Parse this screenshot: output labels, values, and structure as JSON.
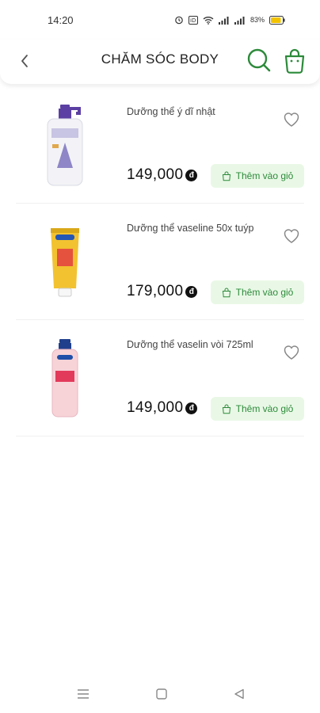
{
  "status_bar": {
    "time": "14:20",
    "battery_percent": "83%"
  },
  "header": {
    "title": "CHĂM SÓC BODY"
  },
  "colors": {
    "accent_green": "#2c8a3a",
    "button_bg": "#e9f8e6"
  },
  "products": [
    {
      "name": "Dưỡng thể ý dĩ nhật",
      "price": "149,000",
      "currency_symbol": "đ",
      "add_to_cart_label": "Thêm vào giỏ"
    },
    {
      "name": "Dưỡng thể vaseline 50x tuýp",
      "price": "179,000",
      "currency_symbol": "đ",
      "add_to_cart_label": "Thêm vào giỏ"
    },
    {
      "name": "Dưỡng thể vaselin vòi 725ml",
      "price": "149,000",
      "currency_symbol": "đ",
      "add_to_cart_label": "Thêm vào giỏ"
    }
  ]
}
